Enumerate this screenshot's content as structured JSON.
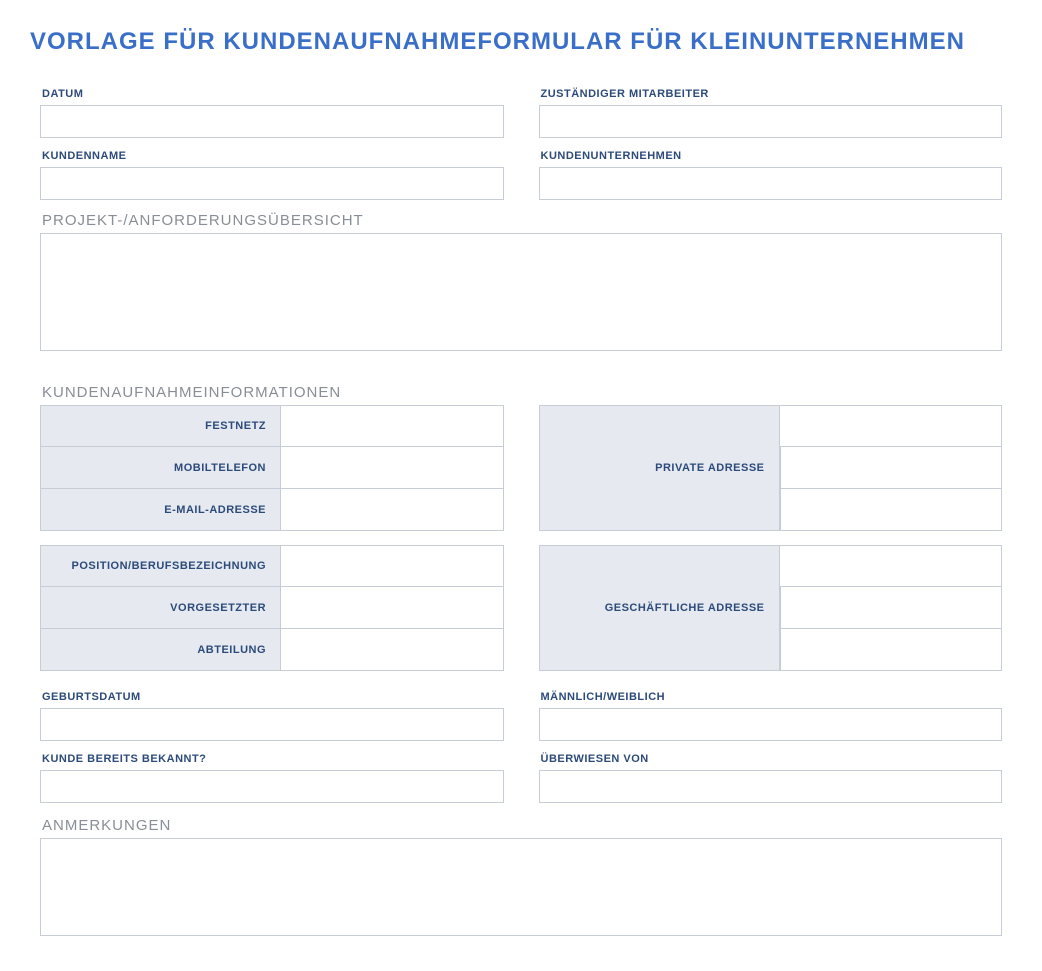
{
  "title": "VORLAGE FÜR KUNDENAUFNAHMEFORMULAR FÜR KLEINUNTERNEHMEN",
  "top": {
    "date_label": "DATUM",
    "date_value": "",
    "staff_label": "ZUSTÄNDIGER MITARBEITER",
    "staff_value": "",
    "client_name_label": "KUNDENNAME",
    "client_name_value": "",
    "client_company_label": "KUNDENUNTERNEHMEN",
    "client_company_value": ""
  },
  "overview": {
    "heading": "PROJEKT-/ANFORDERUNGSÜBERSICHT",
    "value": ""
  },
  "intake": {
    "heading": "KUNDENAUFNAHMEINFORMATIONEN",
    "block1_left": [
      {
        "label": "FESTNETZ",
        "value": ""
      },
      {
        "label": "MOBILTELEFON",
        "value": ""
      },
      {
        "label": "E-MAIL-ADRESSE",
        "value": ""
      }
    ],
    "block1_right_label": "PRIVATE ADRESSE",
    "block1_right_values": [
      "",
      "",
      ""
    ],
    "block2_left": [
      {
        "label": "POSITION/BERUFSBEZEICHNUNG",
        "value": ""
      },
      {
        "label": "VORGESETZTER",
        "value": ""
      },
      {
        "label": "ABTEILUNG",
        "value": ""
      }
    ],
    "block2_right_label": "GESCHÄFTLICHE ADRESSE",
    "block2_right_values": [
      "",
      "",
      ""
    ]
  },
  "extra": {
    "dob_label": "GEBURTSDATUM",
    "dob_value": "",
    "gender_label": "MÄNNLICH/WEIBLICH",
    "gender_value": "",
    "returning_label": "KUNDE BEREITS BEKANNT?",
    "returning_value": "",
    "referred_label": "ÜBERWIESEN VON",
    "referred_value": ""
  },
  "notes": {
    "heading": "ANMERKUNGEN",
    "value": ""
  }
}
